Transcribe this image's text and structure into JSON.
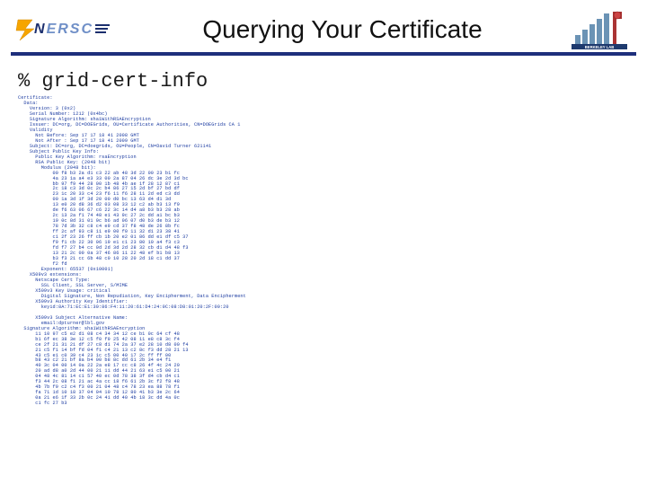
{
  "header": {
    "nersc_first_letter": "N",
    "nersc_rest": "ERSC",
    "title": "Querying Your Certificate",
    "lab_label": "BERKELEY LAB"
  },
  "command": "% grid-cert-info",
  "certificate_text": "Certificate:\n  Data:\n    Version: 3 (0x2)\n    Serial Number: 1212 (0x4bc)\n    Signature Algorithm: sha1WithRSAEncryption\n    Issuer: DC=org, DC=DOEGrids, OU=Certificate Authorities, CN=DOEGrids CA 1\n    Validity\n      Not Before: Sep 17 17 18 41 2008 GMT\n      Not After : Sep 17 17 18 41 2009 GMT\n    Subject: DC=org, DC=doegrids, OU=People, CN=David Turner 621141\n    Subject Public Key Info:\n      Public Key Algorithm: rsaEncryption\n      RSA Public Key: (2048 bit)\n        Modulus (2048 bit):\n            00 f8 b3 2a d1 c3 22 ab 48 3d 22 00 23 b1 fc\n            4a 23 1a a4 e3 33 00 2a 87 04 26 dc 3e 2d 3d bc\n            bb 97 f9 44 28 00 1b 48 4b ae 1f 28 12 87 c1\n            2c 18 c3 3d 0c 2c b4 86 27 15 2d bf 27 bd df\n            23 1c 20 33 c4 23 f6 11 f6 28 11 2d ed c3 dd\n            00 1a 3d 1f 3d 20 00 d0 bc 13 63 d4 d1 3d\n            13 e0 20 d8 36 d2 03 08 33 12 c2 ab b3 13 f9\n            de f6 63 06 67 c6 22 3c 14 d4 a8 b3 b3 28 ab\n            2c 13 2a f1 74 48 e1 43 9c 27 2c dd a1 bc b3\n            19 0c 8d 31 01 9c b6 ad 06 07 d0 b3 de b3 12\n            78 7d 3b 32 c8 c4 e9 cd 37 f8 48 de 26 8b fc\n            ff 2c af 93 c8 11 e9 00 f0 11 32 d1 23 38 41\n            c1 2f 23 26 ff cb 1b 20 e2 01 86 dd e1 df c5 37\n            f9 f1 cb 22 30 06 19 e1 c1 23 80 10 a4 f3 c3\n            fd f7 27 b4 cc 0d 2d 3d 2d 28 32 cb d1 d4 48 f3\n            13 21 2c 00 0a 37 46 86 11 22 48 ef b1 b8 13\n            b3 f3 21 cc 6b 48 c0 10 28 20 2d 18 c1 dd 37\n            f2 fd\n        Exponent: 65537 (0x10001)\n    X509v3 extensions:\n      Netscape Cert Type:\n        SSL Client, SSL Server, S/MIME\n      X509v3 Key Usage: critical\n        Digital Signature, Non Repudiation, Key Encipherment, Data Encipherment\n      X509v3 Authority Key Identifier:\n        keyid:8A:71:EC:E1:30:86:F4:11:20:61:D4:24:0C:08:D8:01:20:2F:00:20\n\n      X509v3 Subject Alternative Name:\n        email:dpturner@lbl.gov\n  Signature Algorithm: sha1WithRSAEncryption\n      11 10 97 c5 e2 d1 08 c4 34 34 12 ce b1 0c 64 cf 48\n      b1 6f ec 38 3e 12 c5 f0 f9 25 42 08 11 e8 c8 3c f4\n      ce 2f 21 31 21 df 27 c8 d1 74 2a 37 e2 28 10 d8 00 f4\n      21 c5 f1 14 bf fd 04 f1 c4 21 13 c2 8c f3 dd 28 21 13\n      43 c5 e1 c0 39 c4 23 1c c5 00 40 17 2c ff ff 00\n      b8 43 c2 21 bf 8a b4 00 b8 8c dd 61 2b 34 e4 f1\n      40 3c 04 00 14 0a 22 2a e8 17 cc c8 26 4f 4c 24 20\n      20 ad d8 a0 2d 44 00 21 11 dd 44 21 63 e1 c5 00 21\n      04 48 4c 81 14 c1 57 40 ec 0d 78 38 3f d4 cb d4 c1\n      f3 44 2c 08 f1 21 ac 4a cc 18 f6 61 2b 3c f2 f8 48\n      4b 7b f9 c2 c4 f3 00 21 04 48 c4 78 23 ea 88 78 f1\n      fa 71 1d 10 18 37 04 04 10 78 12 80 41 b3 3e 2c 64\n      0a 21 e6 1f 33 2b 0c 24 41 dd 40 4b 18 3c dd 4a 0c\n      c1 fc 27 b3"
}
